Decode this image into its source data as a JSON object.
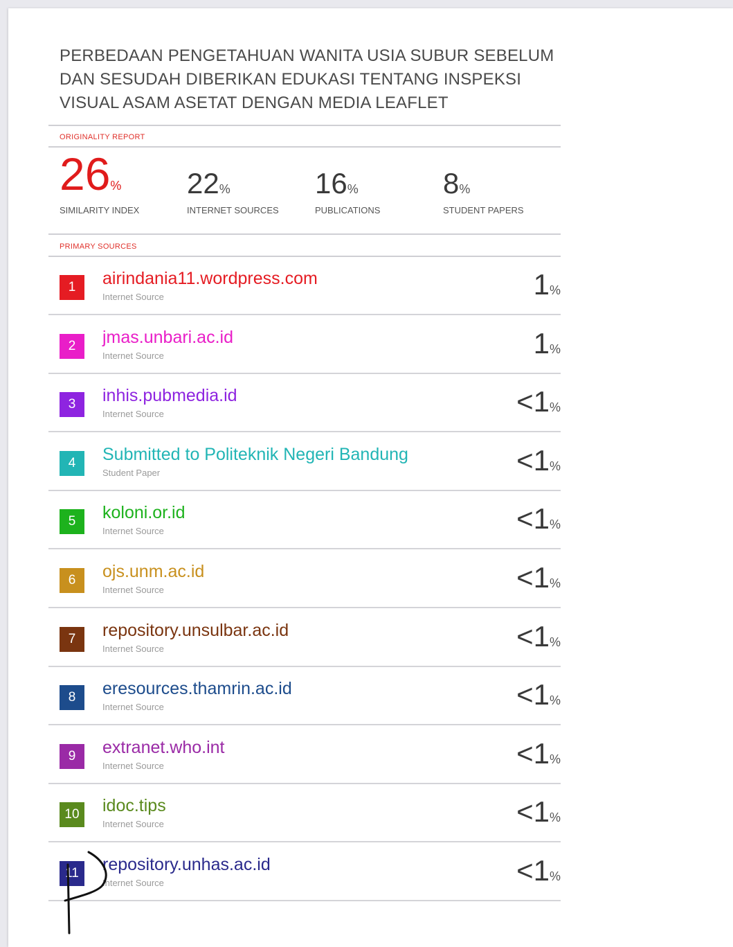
{
  "document": {
    "title": "PERBEDAAN PENGETAHUAN WANITA USIA SUBUR SEBELUM DAN SESUDAH DIBERIKAN EDUKASI TENTANG INSPEKSI VISUAL ASAM ASETAT DENGAN MEDIA LEAFLET",
    "title_lines": [
      "PERBEDAAN PENGETAHUAN WANITA USIA SUBUR SEBELUM",
      "DAN SESUDAH DIBERIKAN EDUKASI TENTANG INSPEKSI",
      "VISUAL ASAM ASETAT DENGAN MEDIA LEAFLET"
    ]
  },
  "originality": {
    "section_label": "ORIGINALITY REPORT",
    "stats": [
      {
        "value": "26",
        "unit": "%",
        "label": "SIMILARITY INDEX"
      },
      {
        "value": "22",
        "unit": "%",
        "label": "INTERNET SOURCES"
      },
      {
        "value": "16",
        "unit": "%",
        "label": "PUBLICATIONS"
      },
      {
        "value": "8",
        "unit": "%",
        "label": "STUDENT PAPERS"
      }
    ]
  },
  "primary_sources": {
    "section_label": "PRIMARY SOURCES",
    "items": [
      {
        "rank": "1",
        "name": "airindania11.wordpress.com",
        "type": "Internet Source",
        "percent": "1",
        "unit": "%",
        "color": "#e51c23"
      },
      {
        "rank": "2",
        "name": "jmas.unbari.ac.id",
        "type": "Internet Source",
        "percent": "1",
        "unit": "%",
        "color": "#e91ec8"
      },
      {
        "rank": "3",
        "name": "inhis.pubmedia.id",
        "type": "Internet Source",
        "percent": "<1",
        "unit": "%",
        "color": "#8e24e0"
      },
      {
        "rank": "4",
        "name": "Submitted to Politeknik Negeri Bandung",
        "type": "Student Paper",
        "percent": "<1",
        "unit": "%",
        "color": "#22b5b5"
      },
      {
        "rank": "5",
        "name": "koloni.or.id",
        "type": "Internet Source",
        "percent": "<1",
        "unit": "%",
        "color": "#1db21d"
      },
      {
        "rank": "6",
        "name": "ojs.unm.ac.id",
        "type": "Internet Source",
        "percent": "<1",
        "unit": "%",
        "color": "#c8901e"
      },
      {
        "rank": "7",
        "name": "repository.unsulbar.ac.id",
        "type": "Internet Source",
        "percent": "<1",
        "unit": "%",
        "color": "#7a3510"
      },
      {
        "rank": "8",
        "name": "eresources.thamrin.ac.id",
        "type": "Internet Source",
        "percent": "<1",
        "unit": "%",
        "color": "#1d4c8c"
      },
      {
        "rank": "9",
        "name": "extranet.who.int",
        "type": "Internet Source",
        "percent": "<1",
        "unit": "%",
        "color": "#9a2aa6"
      },
      {
        "rank": "10",
        "name": "idoc.tips",
        "type": "Internet Source",
        "percent": "<1",
        "unit": "%",
        "color": "#5a8a1e"
      },
      {
        "rank": "11",
        "name": "repository.unhas.ac.id",
        "type": "Internet Source",
        "percent": "<1",
        "unit": "%",
        "color": "#2a2a8c"
      }
    ]
  }
}
